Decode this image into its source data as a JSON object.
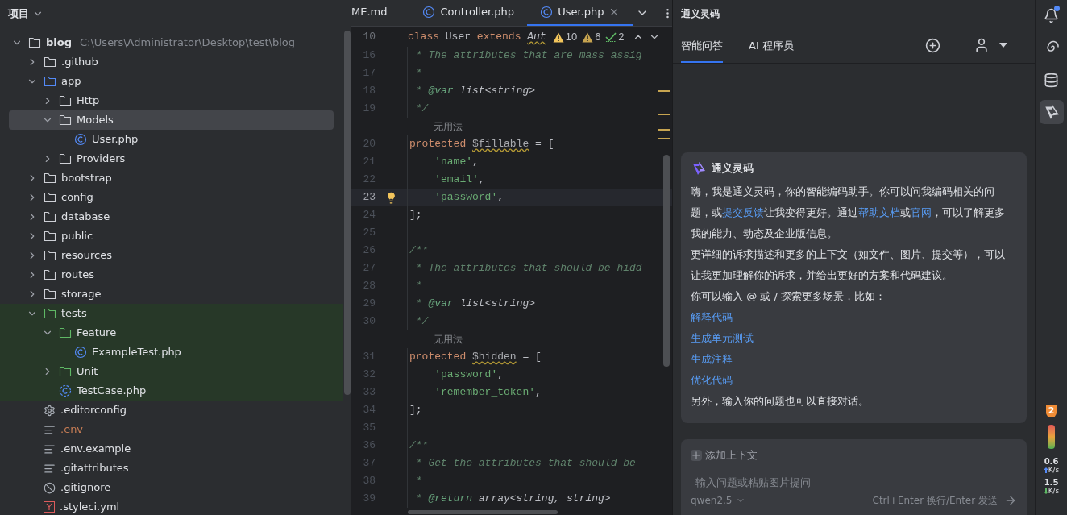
{
  "project_panel": {
    "title": "项目",
    "tree": [
      {
        "label": "blog",
        "path": "C:\\Users\\Administrator\\Desktop\\test\\blog",
        "kind": "folder",
        "expanded": true,
        "selected": false,
        "children": [
          {
            "label": ".github",
            "kind": "folder",
            "expanded": false,
            "selected": false
          },
          {
            "label": "app",
            "kind": "source-folder",
            "expanded": true,
            "selected": false,
            "children": [
              {
                "label": "Http",
                "kind": "folder",
                "expanded": false,
                "selected": false
              },
              {
                "label": "Models",
                "kind": "folder",
                "expanded": true,
                "selected": true,
                "children": [
                  {
                    "label": "User.php",
                    "kind": "class-file",
                    "selected": false
                  }
                ]
              },
              {
                "label": "Providers",
                "kind": "folder",
                "expanded": false,
                "selected": false
              }
            ]
          },
          {
            "label": "bootstrap",
            "kind": "folder",
            "expanded": false,
            "selected": false
          },
          {
            "label": "config",
            "kind": "folder",
            "expanded": false,
            "selected": false
          },
          {
            "label": "database",
            "kind": "folder",
            "expanded": false,
            "selected": false
          },
          {
            "label": "public",
            "kind": "folder",
            "expanded": false,
            "selected": false
          },
          {
            "label": "resources",
            "kind": "folder",
            "expanded": false,
            "selected": false
          },
          {
            "label": "routes",
            "kind": "folder",
            "expanded": false,
            "selected": false
          },
          {
            "label": "storage",
            "kind": "folder",
            "expanded": false,
            "selected": false
          },
          {
            "label": "tests",
            "kind": "test-folder",
            "expanded": true,
            "selected": false,
            "children": [
              {
                "label": "Feature",
                "kind": "test-folder",
                "expanded": true,
                "selected": false,
                "children": [
                  {
                    "label": "ExampleTest.php",
                    "kind": "class-file",
                    "selected": false
                  }
                ]
              },
              {
                "label": "Unit",
                "kind": "test-folder",
                "expanded": false,
                "selected": false
              },
              {
                "label": "TestCase.php",
                "kind": "abstract-class-file",
                "selected": false
              }
            ]
          },
          {
            "label": ".editorconfig",
            "kind": "config-file",
            "selected": false
          },
          {
            "label": ".env",
            "kind": "text-file",
            "selected": false,
            "color": "#c77d55"
          },
          {
            "label": ".env.example",
            "kind": "text-file",
            "selected": false
          },
          {
            "label": ".gitattributes",
            "kind": "text-file",
            "selected": false
          },
          {
            "label": ".gitignore",
            "kind": "ignore-file",
            "selected": false
          },
          {
            "label": ".styleci.yml",
            "kind": "yaml-file",
            "selected": false
          }
        ]
      }
    ]
  },
  "editor": {
    "tabs": [
      {
        "label": "ME.md",
        "kind": "plain",
        "selected": false
      },
      {
        "label": "Controller.php",
        "kind": "class",
        "selected": false
      },
      {
        "label": "User.php",
        "kind": "class",
        "selected": true
      }
    ],
    "sticky_line": {
      "number": "10",
      "tokens": [
        {
          "kind": "keyword",
          "text": "class "
        },
        {
          "kind": "plain",
          "text": "User "
        },
        {
          "kind": "keyword",
          "text": "extends "
        },
        {
          "kind": "parent-class",
          "text": "Aut"
        }
      ]
    },
    "inspections": [
      {
        "kind": "warning",
        "count": "10"
      },
      {
        "kind": "weak-warning",
        "count": "6"
      },
      {
        "kind": "typo",
        "count": "2"
      }
    ],
    "lines": [
      {
        "kind": "code",
        "number": "16",
        "current": false,
        "tokens": [
          {
            "kind": "comment",
            "text": " * The attributes that are mass assig"
          }
        ]
      },
      {
        "kind": "code",
        "number": "17",
        "current": false,
        "tokens": [
          {
            "kind": "comment",
            "text": " *"
          }
        ]
      },
      {
        "kind": "code",
        "number": "18",
        "current": false,
        "tokens": [
          {
            "kind": "comment",
            "text": " * "
          },
          {
            "kind": "doc-tag",
            "text": "@var"
          },
          {
            "kind": "doc-type",
            "text": " list<string>"
          }
        ]
      },
      {
        "kind": "code",
        "number": "19",
        "current": false,
        "tokens": [
          {
            "kind": "comment",
            "text": " */"
          }
        ]
      },
      {
        "kind": "inlay",
        "text": "无用法"
      },
      {
        "kind": "code",
        "number": "20",
        "current": false,
        "tokens": [
          {
            "kind": "keyword",
            "text": "protected "
          },
          {
            "kind": "unused-var",
            "text": "$fillable"
          },
          {
            "kind": "plain",
            "text": " = ["
          }
        ]
      },
      {
        "kind": "code",
        "number": "21",
        "current": false,
        "tokens": [
          {
            "kind": "string",
            "text": "    'name'"
          },
          {
            "kind": "plain",
            "text": ","
          }
        ]
      },
      {
        "kind": "code",
        "number": "22",
        "current": false,
        "tokens": [
          {
            "kind": "string",
            "text": "    'email'"
          },
          {
            "kind": "plain",
            "text": ","
          }
        ]
      },
      {
        "kind": "code",
        "number": "23",
        "current": true,
        "tokens": [
          {
            "kind": "string",
            "text": "    'password'"
          },
          {
            "kind": "plain",
            "text": ","
          }
        ]
      },
      {
        "kind": "code",
        "number": "24",
        "current": false,
        "tokens": [
          {
            "kind": "plain",
            "text": "];"
          }
        ]
      },
      {
        "kind": "code",
        "number": "25",
        "current": false
      },
      {
        "kind": "code",
        "number": "26",
        "current": false,
        "tokens": [
          {
            "kind": "comment",
            "text": "/**"
          }
        ]
      },
      {
        "kind": "code",
        "number": "27",
        "current": false,
        "tokens": [
          {
            "kind": "comment",
            "text": " * The attributes that should be hidd"
          }
        ]
      },
      {
        "kind": "code",
        "number": "28",
        "current": false,
        "tokens": [
          {
            "kind": "comment",
            "text": " *"
          }
        ]
      },
      {
        "kind": "code",
        "number": "29",
        "current": false,
        "tokens": [
          {
            "kind": "comment",
            "text": " * "
          },
          {
            "kind": "doc-tag",
            "text": "@var"
          },
          {
            "kind": "doc-type",
            "text": " list<string>"
          }
        ]
      },
      {
        "kind": "code",
        "number": "30",
        "current": false,
        "tokens": [
          {
            "kind": "comment",
            "text": " */"
          }
        ]
      },
      {
        "kind": "inlay",
        "text": "无用法"
      },
      {
        "kind": "code",
        "number": "31",
        "current": false,
        "tokens": [
          {
            "kind": "keyword",
            "text": "protected "
          },
          {
            "kind": "unused-var",
            "text": "$hidden"
          },
          {
            "kind": "plain",
            "text": " = ["
          }
        ]
      },
      {
        "kind": "code",
        "number": "32",
        "current": false,
        "tokens": [
          {
            "kind": "string",
            "text": "    'password'"
          },
          {
            "kind": "plain",
            "text": ","
          }
        ]
      },
      {
        "kind": "code",
        "number": "33",
        "current": false,
        "tokens": [
          {
            "kind": "string",
            "text": "    'remember_token'"
          },
          {
            "kind": "plain",
            "text": ","
          }
        ]
      },
      {
        "kind": "code",
        "number": "34",
        "current": false,
        "tokens": [
          {
            "kind": "plain",
            "text": "];"
          }
        ]
      },
      {
        "kind": "code",
        "number": "35",
        "current": false
      },
      {
        "kind": "code",
        "number": "36",
        "current": false,
        "tokens": [
          {
            "kind": "comment",
            "text": "/**"
          }
        ]
      },
      {
        "kind": "code",
        "number": "37",
        "current": false,
        "tokens": [
          {
            "kind": "comment",
            "text": " * Get the attributes that should be"
          }
        ]
      },
      {
        "kind": "code",
        "number": "38",
        "current": false,
        "tokens": [
          {
            "kind": "comment",
            "text": " *"
          }
        ]
      },
      {
        "kind": "code",
        "number": "39",
        "current": false,
        "tokens": [
          {
            "kind": "comment",
            "text": " * "
          },
          {
            "kind": "doc-tag",
            "text": "@return"
          },
          {
            "kind": "doc-type",
            "text": " array<string, string>"
          }
        ]
      }
    ]
  },
  "assistant": {
    "title": "通义灵码",
    "tabs": [
      {
        "label": "智能问答",
        "selected": true
      },
      {
        "label": "AI 程序员",
        "selected": false
      }
    ],
    "card": {
      "title": "通义灵码",
      "blocks": [
        {
          "kind": "text",
          "segments": [
            {
              "kind": "text",
              "text": "嗨，我是通义灵码，你的智能编码助手。你可以问我编码相关的问题，或"
            },
            {
              "kind": "link",
              "text": "提交反馈"
            },
            {
              "kind": "text",
              "text": "让我变得更好。通过"
            },
            {
              "kind": "link",
              "text": "帮助文档"
            },
            {
              "kind": "text",
              "text": "或"
            },
            {
              "kind": "link",
              "text": "官网"
            },
            {
              "kind": "text",
              "text": "，可以了解更多我的能力、动态及企业版信息。"
            }
          ]
        },
        {
          "kind": "text",
          "segments": [
            {
              "kind": "text",
              "text": "更详细的诉求描述和更多的上下文（如文件、图片、提交等），可以让我更加理解你的诉求，并给出更好的方案和代码建议。"
            }
          ]
        },
        {
          "kind": "text",
          "segments": [
            {
              "kind": "text",
              "text": "你可以输入 @ 或 / 探索更多场景，比如："
            }
          ]
        },
        {
          "kind": "link",
          "text": "解释代码"
        },
        {
          "kind": "link",
          "text": "生成单元测试"
        },
        {
          "kind": "link",
          "text": "生成注释"
        },
        {
          "kind": "link",
          "text": "优化代码"
        },
        {
          "kind": "text",
          "segments": [
            {
              "kind": "text",
              "text": "另外，输入你的问题也可以直接对话。"
            }
          ]
        }
      ]
    },
    "input": {
      "add_context": "添加上下文",
      "placeholder": "输入问题或粘贴图片提问",
      "model": "qwen2.5",
      "hint": "Ctrl+Enter 换行/Enter 发送"
    }
  },
  "tool_strip": {
    "items": [
      {
        "kind": "notifications",
        "selected": false
      },
      {
        "kind": "spiral",
        "selected": false
      },
      {
        "kind": "database",
        "selected": false
      },
      {
        "kind": "assistant",
        "selected": true
      }
    ],
    "badge": "2",
    "upload": {
      "value": "0.6",
      "unit": "K/s"
    },
    "download": {
      "value": "1.5",
      "unit": "K/s"
    }
  }
}
